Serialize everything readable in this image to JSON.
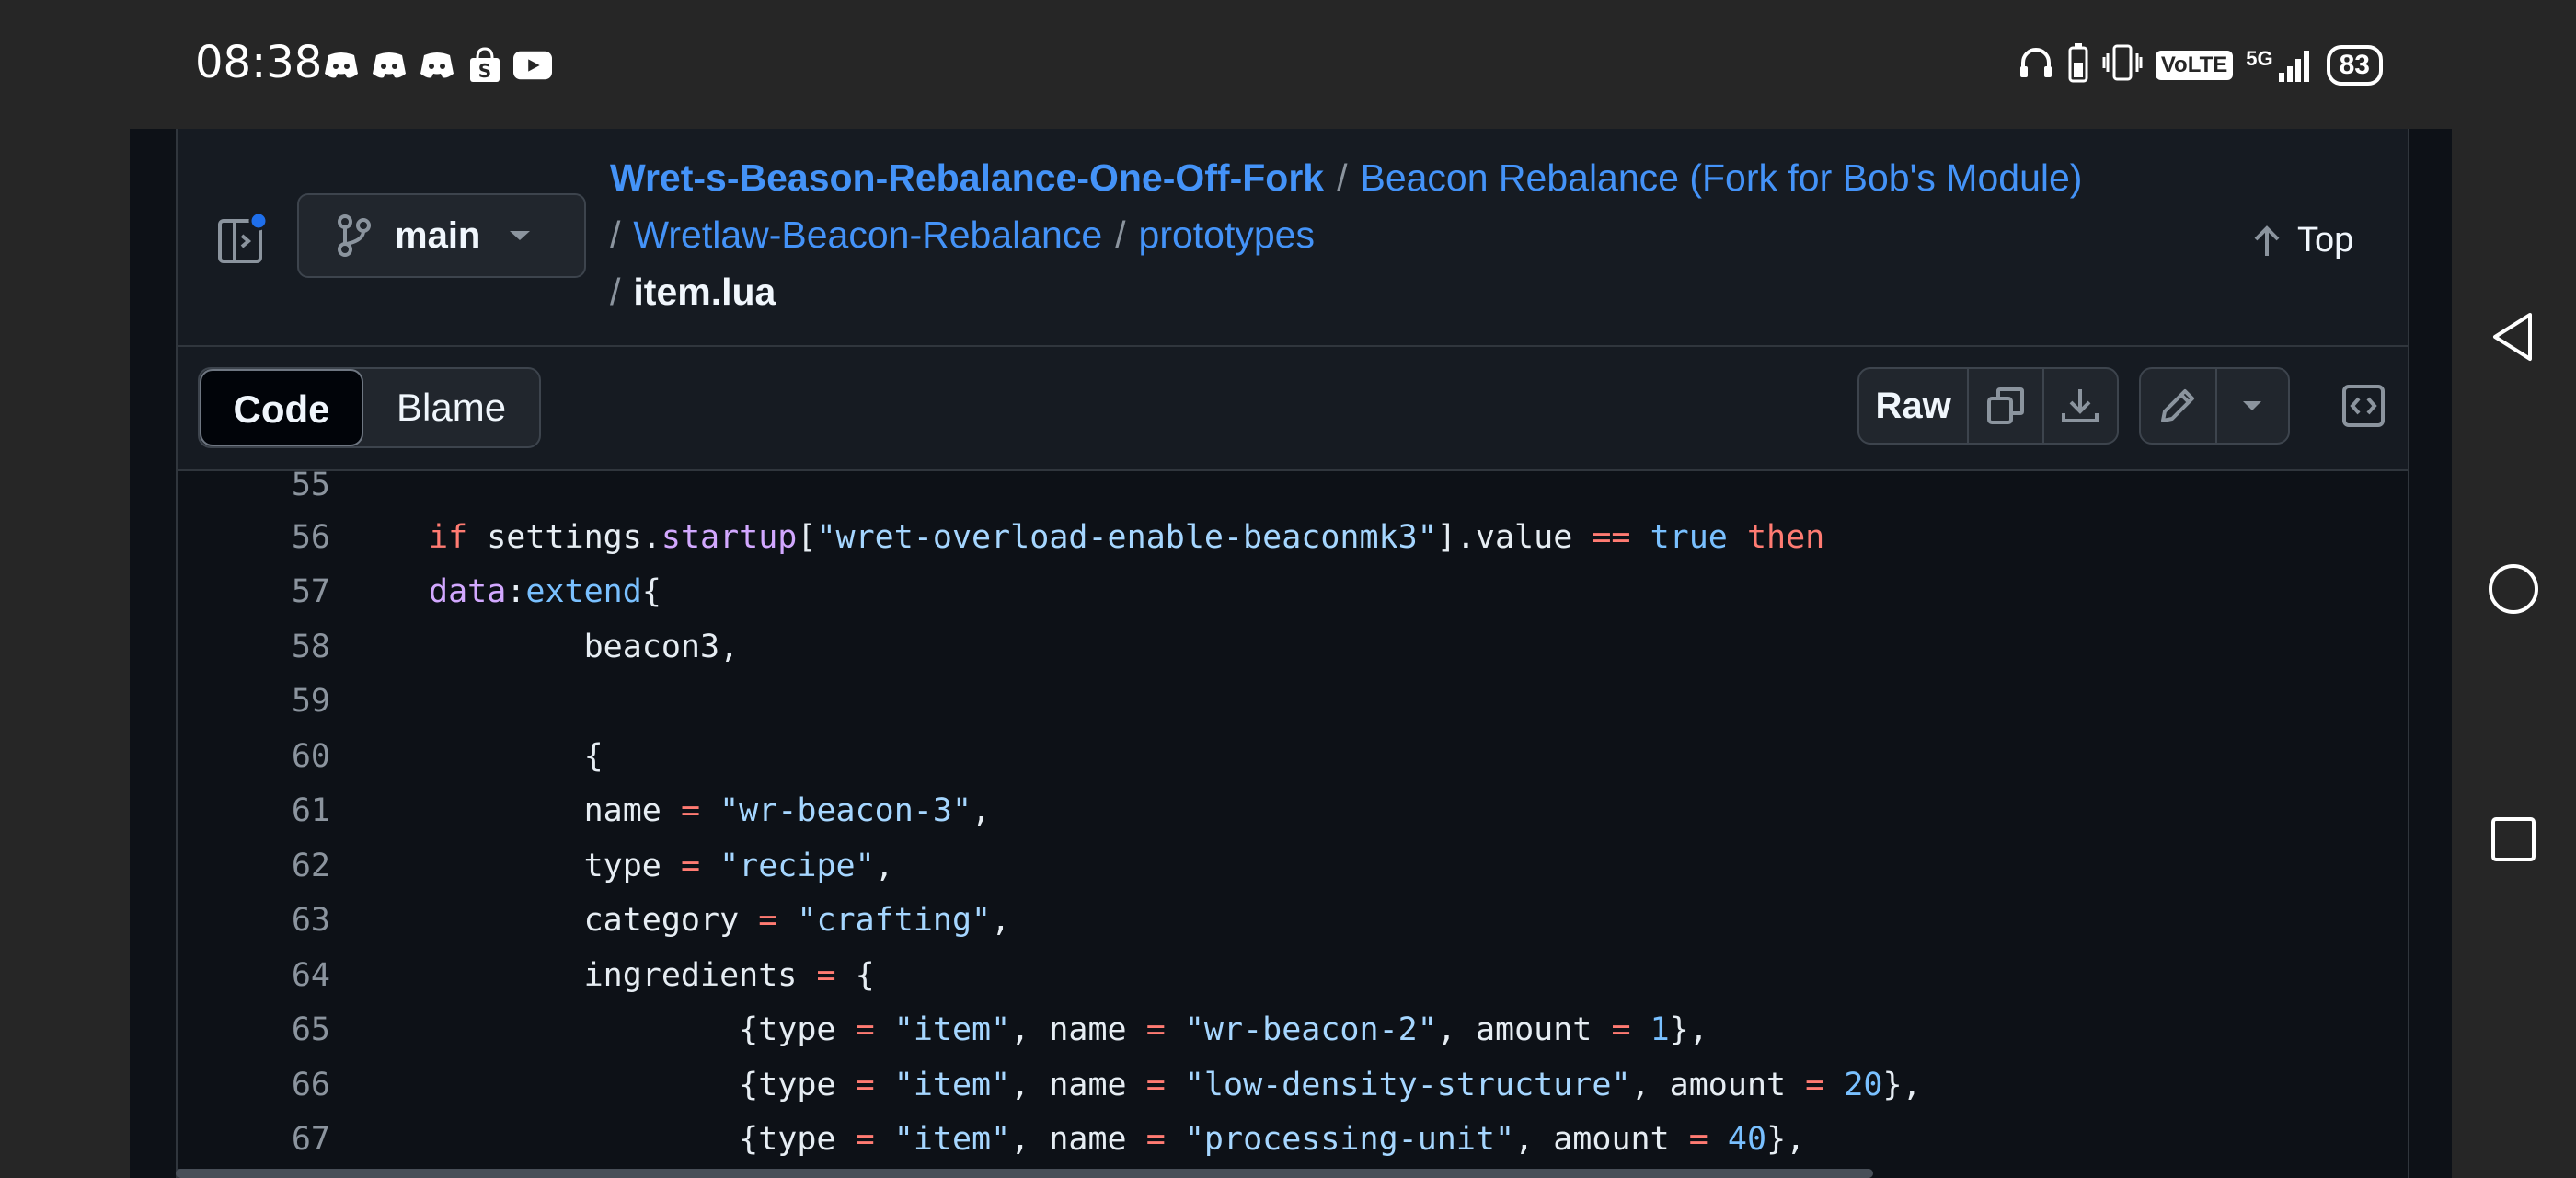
{
  "status_bar": {
    "time": "08:38",
    "notification_icons": [
      "discord-icon",
      "discord-icon",
      "discord-icon",
      "shopee-icon",
      "youtube-icon"
    ],
    "system_icons": [
      "headphones-icon",
      "battery-saver-icon",
      "vibrate-icon",
      "volte-icon",
      "signal-5g-icon"
    ],
    "volte_label": "VoLTE",
    "network_label": "5G",
    "battery": "83"
  },
  "header": {
    "branch": "main",
    "breadcrumb": {
      "repo": "Wret-s-Beason-Rebalance-One-Off-Fork",
      "sep": "/",
      "parts": [
        "Beacon Rebalance (Fork for Bob's Module)",
        "Wretlaw-Beacon-Rebalance",
        "prototypes"
      ],
      "file": "item.lua"
    },
    "top_label": "Top"
  },
  "toolbar": {
    "tabs": [
      "Code",
      "Blame"
    ],
    "active_tab": "Code",
    "raw_label": "Raw"
  },
  "code": {
    "lines": [
      {
        "n": "55",
        "text": ""
      },
      {
        "n": "56",
        "text": "if settings.startup[\"wret-overload-enable-beaconmk3\"].value == true then"
      },
      {
        "n": "57",
        "text": "data:extend{"
      },
      {
        "n": "58",
        "text": "        beacon3,"
      },
      {
        "n": "59",
        "text": ""
      },
      {
        "n": "60",
        "text": "        {"
      },
      {
        "n": "61",
        "text": "        name = \"wr-beacon-3\","
      },
      {
        "n": "62",
        "text": "        type = \"recipe\","
      },
      {
        "n": "63",
        "text": "        category = \"crafting\","
      },
      {
        "n": "64",
        "text": "        ingredients = {"
      },
      {
        "n": "65",
        "text": "                {type = \"item\", name = \"wr-beacon-2\", amount = 1},"
      },
      {
        "n": "66",
        "text": "                {type = \"item\", name = \"low-density-structure\", amount = 20},"
      },
      {
        "n": "67",
        "text": "                {type = \"item\", name = \"processing-unit\", amount = 40},"
      }
    ]
  },
  "colors": {
    "background": "#262626",
    "panel": "#0d1117",
    "header": "#161b22",
    "link": "#4493f8",
    "keyword": "#ff7b72",
    "string": "#a5d6ff",
    "number": "#79c0ff",
    "property": "#d2a8ff",
    "notification_dot": "#1f6feb"
  }
}
